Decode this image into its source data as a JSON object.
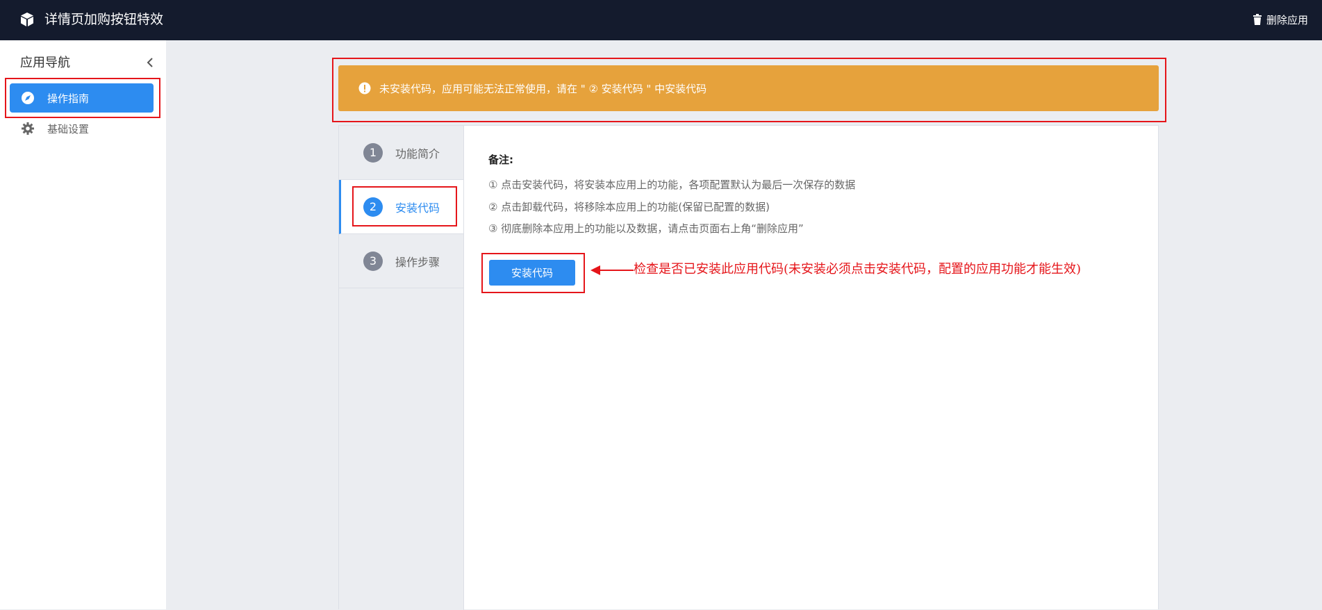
{
  "header": {
    "title": "详情页加购按钮特效",
    "delete_label": "删除应用"
  },
  "sidebar": {
    "title": "应用导航",
    "items": [
      {
        "label": "操作指南",
        "active": true,
        "icon": "compass-icon"
      },
      {
        "label": "基础设置",
        "active": false,
        "icon": "gear-icon"
      }
    ]
  },
  "alert": {
    "text": "未安装代码，应用可能无法正常使用，请在 \" ② 安装代码 \" 中安装代码",
    "color": "#e6a23c"
  },
  "steps": [
    {
      "number": "1",
      "label": "功能简介",
      "active": false
    },
    {
      "number": "2",
      "label": "安装代码",
      "active": true
    },
    {
      "number": "3",
      "label": "操作步骤",
      "active": false
    }
  ],
  "notes": {
    "title": "备注:",
    "lines": [
      "① 点击安装代码，将安装本应用上的功能，各项配置默认为最后一次保存的数据",
      "② 点击卸载代码，将移除本应用上的功能(保留已配置的数据)",
      "③ 彻底删除本应用上的功能以及数据，请点击页面右上角“删除应用”"
    ]
  },
  "install_button": {
    "label": "安装代码"
  },
  "annotation": {
    "text": "检查是否已安装此应用代码(未安装必须点击安装代码，配置的应用功能才能生效)"
  },
  "colors": {
    "primary": "#2d8cf0",
    "header_bg": "#141b2d",
    "highlight_red": "#e5151a"
  }
}
